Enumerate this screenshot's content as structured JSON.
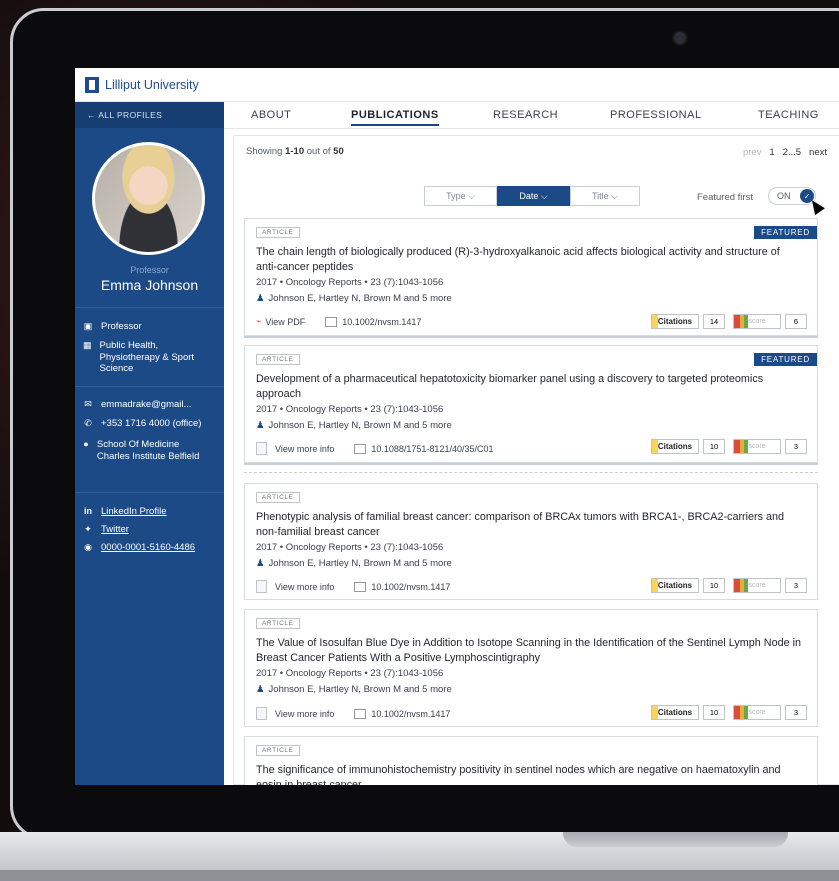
{
  "header": {
    "university": "Lilliput University"
  },
  "sidebar": {
    "back_label": "← ALL PROFILES",
    "role": "Professor",
    "name": "Emma Johnson",
    "info": [
      {
        "icon": "briefcase-icon",
        "text": "Professor"
      },
      {
        "icon": "building-icon",
        "text": "Public Health, Physiotherapy & Sport Science"
      },
      {
        "icon": "email-icon",
        "text": "emmadrake@gmail..."
      },
      {
        "icon": "phone-icon",
        "text": "+353 1716 4000 (office)"
      },
      {
        "icon": "location-icon",
        "text": "School Of Medicine Charles Institute Belfield"
      }
    ],
    "links": [
      {
        "icon": "linkedin-icon",
        "text": "LinkedIn Profile"
      },
      {
        "icon": "twitter-icon",
        "text": "Twitter"
      },
      {
        "icon": "orcid-icon",
        "text": "0000-0001-5160-4486"
      }
    ]
  },
  "tabs": [
    "ABOUT",
    "PUBLICATIONS",
    "RESEARCH",
    "PROFESSIONAL",
    "TEACHING"
  ],
  "active_tab": "PUBLICATIONS",
  "results": {
    "showing_prefix": "Showing ",
    "range": "1-10",
    "middle": " out of ",
    "total": "50",
    "pager": {
      "prev": "prev",
      "p1": "1",
      "p2": "2...5",
      "next": "next"
    }
  },
  "sort": {
    "type": "Type ⌵",
    "date": "Date ⌵",
    "title": "Title ⌵"
  },
  "featured_first": {
    "label": "Featured first",
    "state": "ON"
  },
  "publications": [
    {
      "tag": "ARTICLE",
      "featured": "FEATURED",
      "title": "The chain length of biologically produced (R)-3-hydroxyalkanoic acid affects biological activity and structure of anti-cancer peptides",
      "meta": "2017  •  Oncology Reports  •  23 (7):1043-1056",
      "authors": "Johnson E, Hartley N, Brown M and 5 more",
      "action": "View PDF",
      "doi": "10.1002/nvsm.1417",
      "citations_label": "Citations",
      "citations": "14",
      "alt_label": "score",
      "alt": "6"
    },
    {
      "tag": "ARTICLE",
      "featured": "FEATURED",
      "title": "Development of a pharmaceutical hepatotoxicity biomarker panel using a discovery to targeted proteomics approach",
      "meta": "2017  •  Oncology Reports  •  23 (7):1043-1056",
      "authors": "Johnson E, Hartley N, Brown M and 5 more",
      "action": "View more info",
      "doi": "10.1088/1751-8121/40/35/C01",
      "citations_label": "Citations",
      "citations": "10",
      "alt_label": "score",
      "alt": "3"
    },
    {
      "tag": "ARTICLE",
      "title": "Phenotypic analysis of familial breast cancer: comparison of BRCAx tumors with BRCA1-, BRCA2-carriers and non-familial breast cancer",
      "meta": "2017  •  Oncology Reports  •  23 (7):1043-1056",
      "authors": "Johnson E, Hartley N, Brown M and 5 more",
      "action": "View more info",
      "doi": "10.1002/nvsm.1417",
      "citations_label": "Citations",
      "citations": "10",
      "alt_label": "score",
      "alt": "3"
    },
    {
      "tag": "ARTICLE",
      "title": "The Value of Isosulfan Blue Dye in Addition to Isotope Scanning in the Identification of the Sentinel Lymph Node in Breast Cancer Patients With a Positive Lymphoscintigraphy",
      "meta": "2017  •  Oncology Reports  •  23 (7):1043-1056",
      "authors": "Johnson E, Hartley N, Brown M and 5 more",
      "action": "View more info",
      "doi": "10.1002/nvsm.1417",
      "citations_label": "Citations",
      "citations": "10",
      "alt_label": "score",
      "alt": "3"
    },
    {
      "tag": "ARTICLE",
      "title": "The significance of immunohistochemistry positivity in sentinel nodes which are negative on haematoxylin and eosin in breast cancer"
    }
  ]
}
